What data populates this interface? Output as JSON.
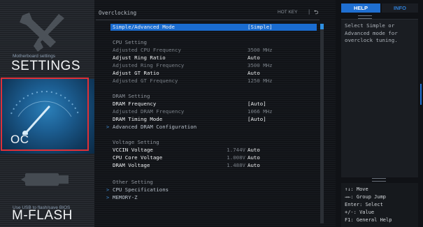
{
  "nav": {
    "settings": {
      "subtitle": "Motherboard settings",
      "title": "SETTINGS"
    },
    "oc": {
      "title": "OC"
    },
    "mflash": {
      "subtitle": "Use USB to flash/save BIOS",
      "title": "M-FLASH"
    }
  },
  "header": {
    "title": "Overclocking",
    "hotkey_label": "HOT KEY",
    "separator": "|"
  },
  "rows": {
    "mode": {
      "label": "Simple/Advanced Mode",
      "value": "[Simple]"
    },
    "cpu_head": "CPU Setting",
    "adj_cpu": {
      "label": "Adjusted CPU Frequency",
      "value": "3500 MHz"
    },
    "ring_ratio": {
      "label": "Adjust Ring Ratio",
      "value": "Auto"
    },
    "adj_ring": {
      "label": "Adjusted Ring Frequency",
      "value": "3500 MHz"
    },
    "gt_ratio": {
      "label": "Adjust GT Ratio",
      "value": "Auto"
    },
    "adj_gt": {
      "label": "Adjusted GT Frequency",
      "value": "1250 MHz"
    },
    "dram_head": "DRAM Setting",
    "dram_freq": {
      "label": "DRAM Frequency",
      "value": "[Auto]"
    },
    "adj_dram": {
      "label": "Adjusted DRAM Frequency",
      "value": "1066 MHz"
    },
    "timing": {
      "label": "DRAM Timing Mode",
      "value": "[Auto]"
    },
    "adv_dram": {
      "label": "Advanced DRAM Configuration"
    },
    "volt_head": "Voltage Setting",
    "vccin": {
      "label": "VCCIN Voltage",
      "reading": "1.744V",
      "value": "Auto"
    },
    "core": {
      "label": "CPU Core Voltage",
      "reading": "1.008V",
      "value": "Auto"
    },
    "dram_v": {
      "label": "DRAM Voltage",
      "reading": "1.488V",
      "value": "Auto"
    },
    "other_head": "Other Setting",
    "cpu_spec": {
      "label": "CPU Specifications"
    },
    "memz": {
      "label": "MEMORY-Z"
    }
  },
  "help": {
    "tab_help": "HELP",
    "tab_info": "INFO",
    "text": "Select Simple or\nAdvanced mode for\noverclock tuning.",
    "keys": [
      "↑↓: Move",
      "→←: Group Jump",
      "Enter: Select",
      "+/-: Value",
      "F1: General Help"
    ]
  },
  "colors": {
    "accent": "#1a6cd0",
    "highlight_border": "#e03038",
    "oc_tile": "#2b7fb8"
  },
  "icons": [
    "tools-icon",
    "gauge-icon",
    "usb-icon",
    "back-icon",
    "arrow-right-icon"
  ]
}
